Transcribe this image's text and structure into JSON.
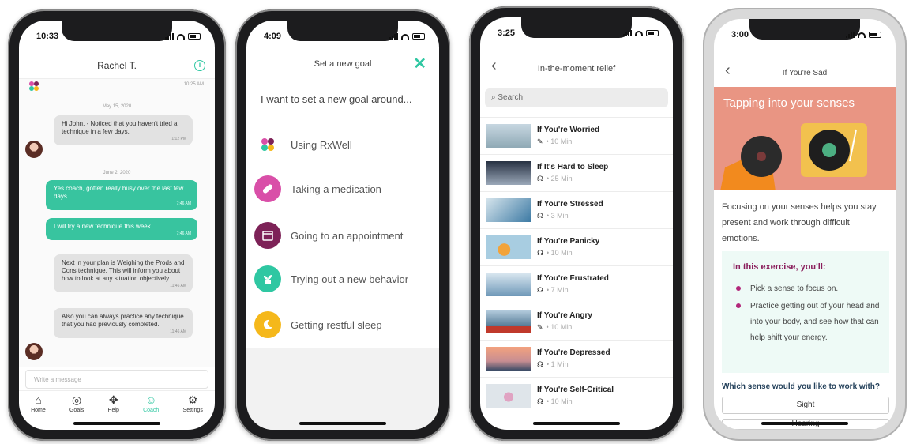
{
  "phone1": {
    "time": "10:33",
    "contact": "Rachel T.",
    "first_time": "10:25 AM",
    "dates": [
      "May 15, 2020",
      "June 2, 2020"
    ],
    "messages": [
      {
        "dir": "in",
        "text": "Hi John, - Noticed that you haven't tried a technique in a few days.",
        "time": "1:12 PM"
      },
      {
        "dir": "out",
        "text": "Yes coach, gotten really busy over the last few days",
        "time": "7:46 AM"
      },
      {
        "dir": "out",
        "text": "I will try a new technique this week",
        "time": "7:46 AM"
      },
      {
        "dir": "in",
        "text": "Next in your plan is Weighing the Prods and Cons technique. This will inform you about how to look at any situation objectively",
        "time": "11:46 AM"
      },
      {
        "dir": "in",
        "text": "Also you can always practice any technique that you had previously completed.",
        "time": "11:46 AM"
      }
    ],
    "compose_placeholder": "Write a message",
    "tabs": [
      {
        "label": "Home",
        "icon": "home-icon",
        "glyph": "⌂"
      },
      {
        "label": "Goals",
        "icon": "target-icon",
        "glyph": "◎"
      },
      {
        "label": "Help",
        "icon": "help-icon",
        "glyph": "✥"
      },
      {
        "label": "Coach",
        "icon": "coach-icon",
        "glyph": "☺"
      },
      {
        "label": "Settings",
        "icon": "gear-icon",
        "glyph": "⚙"
      }
    ],
    "accent": "#2fc7a2"
  },
  "phone2": {
    "time": "4:09",
    "title": "Set a new goal",
    "prompt": "I want to set a new goal around...",
    "goals": [
      {
        "label": "Using RxWell",
        "icon": "rxwell-logo-icon",
        "color": "#ffffff"
      },
      {
        "label": "Taking a medication",
        "icon": "pill-icon",
        "color": "#d94fa8"
      },
      {
        "label": "Going to an appointment",
        "icon": "calendar-icon",
        "color": "#7d2257"
      },
      {
        "label": "Trying out a new behavior",
        "icon": "plant-icon",
        "color": "#2fc7a2"
      },
      {
        "label": "Getting restful sleep",
        "icon": "moon-icon",
        "color": "#f5b81b"
      }
    ]
  },
  "phone3": {
    "time": "3:25",
    "title": "In-the-moment relief",
    "search_placeholder": "Search",
    "items": [
      {
        "name": "If You're Worried",
        "media": "note-icon",
        "duration": "10 Min"
      },
      {
        "name": "If It's Hard to Sleep",
        "media": "headphones-icon",
        "duration": "25 Min"
      },
      {
        "name": "If You're Stressed",
        "media": "headphones-icon",
        "duration": "3 Min"
      },
      {
        "name": "If You're Panicky",
        "media": "headphones-icon",
        "duration": "10 Min"
      },
      {
        "name": "If You're Frustrated",
        "media": "headphones-icon",
        "duration": "7 Min"
      },
      {
        "name": "If You're Angry",
        "media": "note-icon",
        "duration": "10 Min"
      },
      {
        "name": "If You're Depressed",
        "media": "headphones-icon",
        "duration": "1 Min"
      },
      {
        "name": "If You're Self-Critical",
        "media": "headphones-icon",
        "duration": "10 Min"
      }
    ]
  },
  "phone4": {
    "time": "3:00",
    "title": "If You're Sad",
    "hero_title": "Tapping into your senses",
    "body": "Focusing on your senses helps you stay present and work through difficult emotions.",
    "exercise_heading": "In this exercise, you'll:",
    "exercise_points": [
      "Pick a sense to focus on.",
      "Practice getting out of your head and into your body, and see how that can help shift your energy."
    ],
    "question": "Which sense would you like to work with?",
    "options": [
      "Sight",
      "Hearing"
    ]
  }
}
